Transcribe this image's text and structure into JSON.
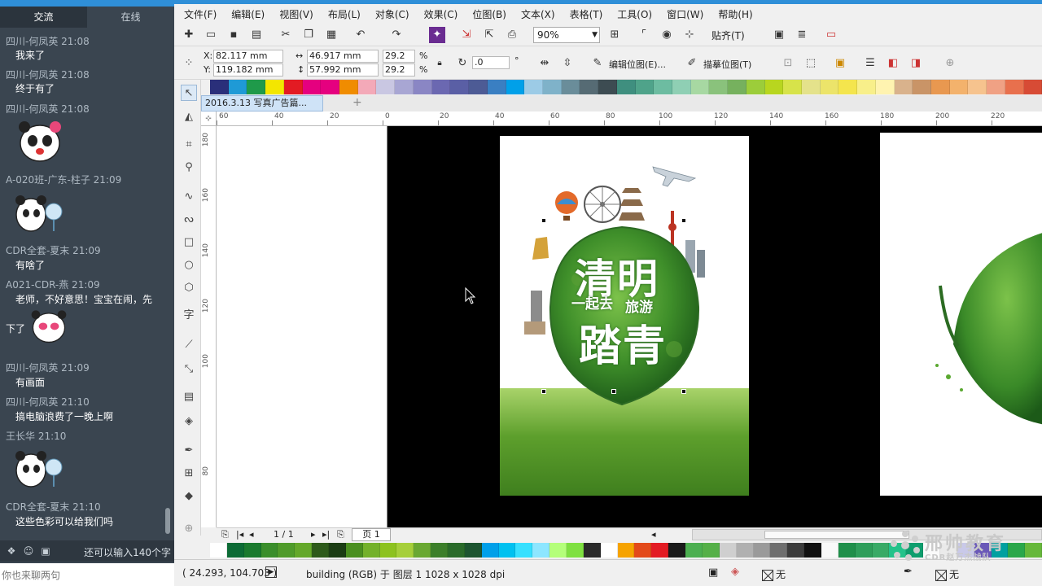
{
  "chat": {
    "tabs": [
      "交流",
      "在线"
    ],
    "messages": [
      {
        "name": "四川-何凤英 21:08",
        "text": "我来了"
      },
      {
        "name": "四川-何凤英 21:08",
        "text": "终于有了"
      },
      {
        "name": "四川-何凤英 21:08",
        "text": ""
      },
      {
        "name": "A-020班-广东-柱子 21:09",
        "text": ""
      },
      {
        "name": "CDR全套-夏末 21:09",
        "text": "有啥了"
      },
      {
        "name": "A021-CDR-燕 21:09",
        "text": "老师，不好意思！宝宝在闹，先"
      },
      {
        "name": "",
        "text": "下了"
      },
      {
        "name": "四川-何凤英 21:09",
        "text": "有画面"
      },
      {
        "name": "四川-何凤英 21:10",
        "text": "搞电脑浪费了一晚上啊"
      },
      {
        "name": "王长华 21:10",
        "text": ""
      },
      {
        "name": "CDR全套-夏末 21:10",
        "text": "这些色彩可以给我们吗"
      }
    ],
    "first_partial_name": "四川-何凤英 21:08",
    "char_limit": "还可以输入140个字",
    "input_placeholder": "你也来聊两句"
  },
  "menu": [
    "文件(F)",
    "编辑(E)",
    "视图(V)",
    "布局(L)",
    "对象(C)",
    "效果(C)",
    "位图(B)",
    "文本(X)",
    "表格(T)",
    "工具(O)",
    "窗口(W)",
    "帮助(H)"
  ],
  "toolbar": {
    "zoom": "90%",
    "snap_label": "贴齐(T)"
  },
  "properties": {
    "x_label": "X:",
    "x": "82.117 mm",
    "y_label": "Y:",
    "y": "119.182 mm",
    "w": "46.917 mm",
    "h": "57.992 mm",
    "scale_w": "29.2",
    "scale_h": "29.2",
    "pct": "%",
    "angle": ".0",
    "deg": "°",
    "edit_bitmap": "编辑位图(E)...",
    "trace_bitmap": "描摹位图(T)"
  },
  "document": {
    "tab_title": "2016.3.13 写真广告篇...",
    "add_tab": "+"
  },
  "rulers": {
    "h_ticks": [
      "60",
      "40",
      "20",
      "0",
      "20",
      "40",
      "60",
      "80",
      "100",
      "120",
      "140",
      "160",
      "180",
      "200",
      "220"
    ],
    "v_ticks": [
      "180",
      "160",
      "140",
      "120",
      "100",
      "80"
    ]
  },
  "poster": {
    "title_top": "清明",
    "sub_left": "一起去",
    "sub_right": "旅游",
    "title_bottom": "踏青"
  },
  "pagenav": {
    "page_count": "1 / 1",
    "page_tab": "页 1"
  },
  "status": {
    "coords": "( 24.293, 104.703 )",
    "info": "building (RGB) 于 图层 1 1028 x 1028 dpi",
    "fill": "无",
    "outline": "无"
  },
  "watermark": {
    "title": "邢帅教育",
    "subtitle": "CDR赵万杰战队"
  },
  "palette_top": [
    "#2a2f7a",
    "#1f9ad6",
    "#1f9a4a",
    "#f3e600",
    "#e31b23",
    "#e5007f",
    "#e5007f",
    "#f08c00",
    "#f3a9b8",
    "#c9c7e2",
    "#a8a6d3",
    "#8a86c4",
    "#6b68b1",
    "#5a5fa5",
    "#4d5b95",
    "#3a7fc2",
    "#00a0e9",
    "#9ccbe6",
    "#7fb2c9",
    "#6a8d9a",
    "#566b74",
    "#3d4c52",
    "#3f8f7f",
    "#4fa38a",
    "#6dbca1",
    "#8fcfb4",
    "#a7d8a2",
    "#8ac27c",
    "#76b15e",
    "#9ccd3a",
    "#b8d61f",
    "#d7e34a",
    "#e4e28b",
    "#ece46a",
    "#f4e54d",
    "#f8ef8a",
    "#fff3b0",
    "#d9b28c",
    "#c99467",
    "#e89850",
    "#f3b26c",
    "#f6c38e",
    "#f0a184",
    "#e8704d",
    "#d74b35"
  ],
  "palette_bottom": [
    "#ffffff",
    "#0c6b35",
    "#1a7a2e",
    "#3a8e2b",
    "#4f9b2a",
    "#64a82a",
    "#2d5a1a",
    "#1b3d14",
    "#4a8f1f",
    "#73b12a",
    "#8dc21f",
    "#a6cf3a",
    "#6aa832",
    "#3c7f2a",
    "#2a6b2a",
    "#1d5530",
    "#00a0e9",
    "#00c1f0",
    "#37e0ff",
    "#8de6ff",
    "#b4ff7a",
    "#7fe041",
    "#2a2a2a",
    "#ffffff",
    "#f6a300",
    "#e34a1a",
    "#e31b23",
    "#1a1a1a",
    "#4caf50",
    "#55b048",
    "#cfcfcf",
    "#b0b0b0",
    "#9a9a9a",
    "#6f6f6f",
    "#3c3c3c",
    "#111111",
    "#f9f9f9",
    "#1f8f4a",
    "#2e9e5a",
    "#39aa66",
    "#23c28a",
    "#0f9e6e",
    "#fafafa",
    "#eaeaea",
    "#c9c9e9",
    "#6a58b8",
    "#00a0a0",
    "#2aa74a",
    "#66b83a"
  ]
}
